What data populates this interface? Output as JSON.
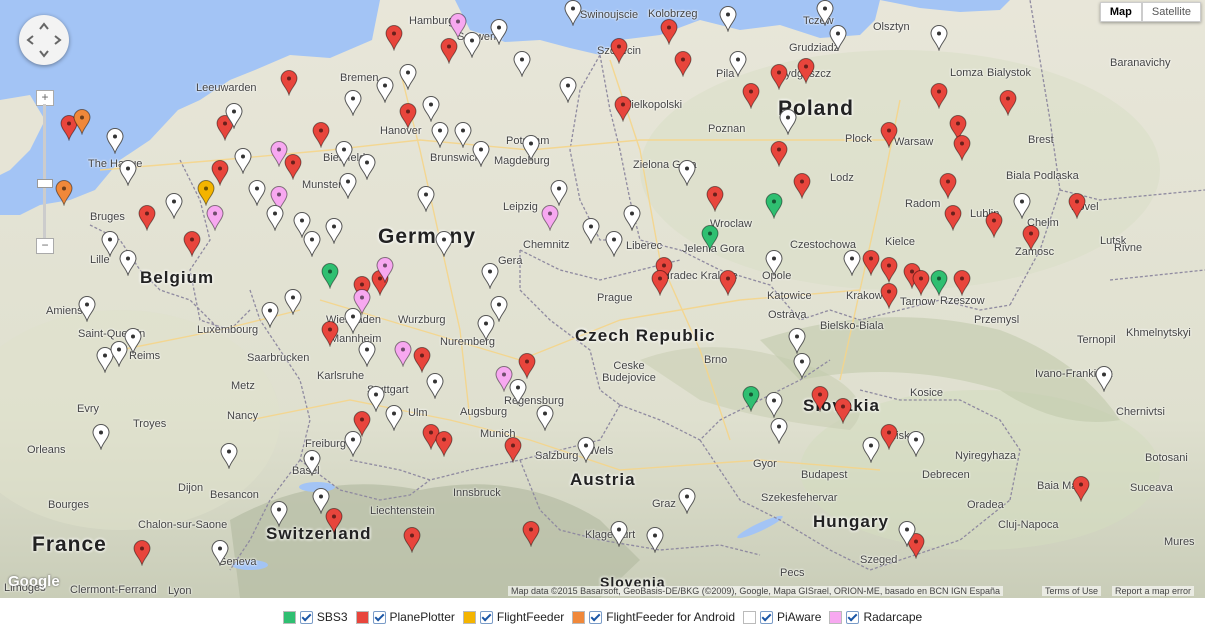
{
  "map_controls": {
    "map_label": "Map",
    "satellite_label": "Satellite",
    "zoom_in": "+",
    "zoom_out": "−"
  },
  "countries": [
    "Poland",
    "Germany",
    "Belgium",
    "Czech Republic",
    "Slovakia",
    "Austria",
    "Hungary",
    "France",
    "Switzerland",
    "Slovenia"
  ],
  "cities": [
    "Hamburg",
    "Schwerin",
    "Swinoujscie",
    "Kolobrzeg",
    "Tczew",
    "Olsztyn",
    "Szczecin",
    "Grudziadz",
    "Bialystok",
    "Baranavichy",
    "Bremen",
    "Pila",
    "Bydgoszcz",
    "Lomza",
    "Wielkopolski",
    "Leeuwarden",
    "Poznan",
    "Brest",
    "Hanover",
    "Potsdam",
    "Plock",
    "Warsaw",
    "The Hague",
    "Bielefeld",
    "Brunswick",
    "Magdeburg",
    "Zielona Gora",
    "Lodz",
    "Biala Podlaska",
    "Munster",
    "Radom",
    "Kovel",
    "Bruges",
    "Leipzig",
    "Wroclaw",
    "Lublin",
    "Chelm",
    "Jelenia Gora",
    "Czestochowa",
    "Kielce",
    "Zamosc",
    "Lille",
    "Chemnitz",
    "Liberec",
    "Lutsk",
    "Gera",
    "Hradec Kralove",
    "Opole",
    "Rivne",
    "Amiens",
    "Katowice",
    "Krakow",
    "Tarnow",
    "Rzeszow",
    "Prague",
    "Ostrava",
    "Bielsko-Biala",
    "Przemysl",
    "Luxembourg",
    "Wiesbaden",
    "Wurzburg",
    "Ternopil",
    "Khmelnytskyi",
    "Saint-Quentin",
    "Mannheim",
    "Nuremberg",
    "Brno",
    "Reims",
    "Saarbrucken",
    "Ceske Budejovice",
    "Ivano-Frankivsk",
    "Metz",
    "Karlsruhe",
    "Stuttgart",
    "Regensburg",
    "Kosice",
    "Evry",
    "Nancy",
    "Ulm",
    "Augsburg",
    "Munich",
    "Chernivtsi",
    "Troyes",
    "Salzburg",
    "Wels",
    "Miskolc",
    "Orleans",
    "Freiburg",
    "Basel",
    "Gyor",
    "Budapest",
    "Nyiregyhaza",
    "Botosani",
    "Dijon",
    "Besancon",
    "Innsbruck",
    "Debrecen",
    "Baia Mare",
    "Suceava",
    "Bourges",
    "Szekesfehervar",
    "Chalon-sur-Saone",
    "Liechtenstein",
    "Graz",
    "Klagenfurt",
    "Oradea",
    "Cluj-Napoca",
    "Geneva",
    "Szeged",
    "Mures",
    "Pecs",
    "Limoges",
    "Clermont-Ferrand",
    "Lyon"
  ],
  "attribution": {
    "data": "Map data ©2015 Basarsoft, GeoBasis-DE/BKG (©2009), Google, Mapa GISrael, ORION-ME, basado en BCN IGN España",
    "terms": "Terms of Use",
    "report": "Report a map error",
    "logo": "Google"
  },
  "legend": [
    {
      "label": "SBS3",
      "color": "#2fbf71"
    },
    {
      "label": "PlanePlotter",
      "color": "#e8453c"
    },
    {
      "label": "FlightFeeder",
      "color": "#f4b400"
    },
    {
      "label": "FlightFeeder for Android",
      "color": "#f0883a"
    },
    {
      "label": "PiAware",
      "color": "#ffffff"
    },
    {
      "label": "Radarcape",
      "color": "#f7a8f0"
    }
  ],
  "markers": [
    {
      "type": "planeplotter",
      "lon": 4.9,
      "lat": 52.4
    },
    {
      "type": "planeplotter",
      "lon": 3.2,
      "lat": 51.0
    },
    {
      "type": "planeplotter",
      "lon": 4.8,
      "lat": 51.7
    },
    {
      "type": "planeplotter",
      "lon": 4.2,
      "lat": 50.6
    },
    {
      "type": "planeplotter",
      "lon": 6.3,
      "lat": 53.1
    },
    {
      "type": "planeplotter",
      "lon": 7.0,
      "lat": 52.3
    },
    {
      "type": "planeplotter",
      "lon": 8.9,
      "lat": 52.6
    },
    {
      "type": "planeplotter",
      "lon": 9.8,
      "lat": 53.6
    },
    {
      "type": "planeplotter",
      "lon": 6.4,
      "lat": 51.8
    },
    {
      "type": "planeplotter",
      "lon": 7.9,
      "lat": 49.9
    },
    {
      "type": "planeplotter",
      "lon": 8.3,
      "lat": 50.0
    },
    {
      "type": "planeplotter",
      "lon": 7.2,
      "lat": 49.2
    },
    {
      "type": "planeplotter",
      "lon": 9.2,
      "lat": 48.8
    },
    {
      "type": "planeplotter",
      "lon": 7.9,
      "lat": 47.8
    },
    {
      "type": "planeplotter",
      "lon": 9.4,
      "lat": 47.6
    },
    {
      "type": "planeplotter",
      "lon": 9.7,
      "lat": 47.5
    },
    {
      "type": "planeplotter",
      "lon": 11.5,
      "lat": 48.7
    },
    {
      "type": "planeplotter",
      "lon": 11.2,
      "lat": 47.4
    },
    {
      "type": "planeplotter",
      "lon": 13.5,
      "lat": 53.6
    },
    {
      "type": "planeplotter",
      "lon": 13.6,
      "lat": 52.7
    },
    {
      "type": "planeplotter",
      "lon": 14.9,
      "lat": 53.4
    },
    {
      "type": "planeplotter",
      "lon": 15.6,
      "lat": 51.3
    },
    {
      "type": "planeplotter",
      "lon": 14.5,
      "lat": 50.2
    },
    {
      "type": "planeplotter",
      "lon": 14.4,
      "lat": 50.0
    },
    {
      "type": "planeplotter",
      "lon": 15.9,
      "lat": 50.0
    },
    {
      "type": "planeplotter",
      "lon": 17.0,
      "lat": 53.2
    },
    {
      "type": "planeplotter",
      "lon": 17.6,
      "lat": 53.3
    },
    {
      "type": "planeplotter",
      "lon": 16.4,
      "lat": 52.9
    },
    {
      "type": "planeplotter",
      "lon": 17.0,
      "lat": 52.0
    },
    {
      "type": "planeplotter",
      "lon": 17.5,
      "lat": 51.5
    },
    {
      "type": "planeplotter",
      "lon": 19.4,
      "lat": 52.3
    },
    {
      "type": "planeplotter",
      "lon": 20.5,
      "lat": 52.9
    },
    {
      "type": "planeplotter",
      "lon": 20.9,
      "lat": 52.4
    },
    {
      "type": "planeplotter",
      "lon": 21.0,
      "lat": 52.1
    },
    {
      "type": "planeplotter",
      "lon": 20.7,
      "lat": 51.5
    },
    {
      "type": "planeplotter",
      "lon": 22.0,
      "lat": 52.8
    },
    {
      "type": "planeplotter",
      "lon": 20.8,
      "lat": 51.0
    },
    {
      "type": "planeplotter",
      "lon": 21.7,
      "lat": 50.9
    },
    {
      "type": "planeplotter",
      "lon": 22.5,
      "lat": 50.7
    },
    {
      "type": "planeplotter",
      "lon": 23.5,
      "lat": 51.2
    },
    {
      "type": "planeplotter",
      "lon": 19.0,
      "lat": 50.3
    },
    {
      "type": "planeplotter",
      "lon": 19.4,
      "lat": 50.2
    },
    {
      "type": "planeplotter",
      "lon": 19.9,
      "lat": 50.1
    },
    {
      "type": "planeplotter",
      "lon": 20.1,
      "lat": 50.0
    },
    {
      "type": "planeplotter",
      "lon": 21.0,
      "lat": 50.0
    },
    {
      "type": "planeplotter",
      "lon": 19.4,
      "lat": 49.8
    },
    {
      "type": "planeplotter",
      "lon": 17.9,
      "lat": 48.2
    },
    {
      "type": "planeplotter",
      "lon": 18.4,
      "lat": 48.0
    },
    {
      "type": "planeplotter",
      "lon": 19.4,
      "lat": 47.6
    },
    {
      "type": "planeplotter",
      "lon": 23.6,
      "lat": 46.8
    },
    {
      "type": "planeplotter",
      "lon": 20.0,
      "lat": 45.9
    },
    {
      "type": "planeplotter",
      "lon": 3.1,
      "lat": 45.8
    },
    {
      "type": "planeplotter",
      "lon": 7.3,
      "lat": 46.3
    },
    {
      "type": "planeplotter",
      "lon": 9.0,
      "lat": 46.0
    },
    {
      "type": "planeplotter",
      "lon": 11.6,
      "lat": 46.1
    },
    {
      "type": "planeplotter",
      "lon": 8.6,
      "lat": 53.8
    },
    {
      "type": "planeplotter",
      "lon": 1.5,
      "lat": 52.4
    },
    {
      "type": "planeplotter",
      "lon": 14.6,
      "lat": 53.9
    },
    {
      "type": "sbs3",
      "lon": 15.5,
      "lat": 50.7
    },
    {
      "type": "sbs3",
      "lon": 16.9,
      "lat": 51.2
    },
    {
      "type": "sbs3",
      "lon": 20.5,
      "lat": 50.0
    },
    {
      "type": "sbs3",
      "lon": 7.2,
      "lat": 50.1
    },
    {
      "type": "sbs3",
      "lon": 16.4,
      "lat": 48.2
    },
    {
      "type": "flightfeeder",
      "lon": 4.5,
      "lat": 51.4
    },
    {
      "type": "flightfeeder-android",
      "lon": 1.8,
      "lat": 52.5
    },
    {
      "type": "flightfeeder-android",
      "lon": 1.4,
      "lat": 51.4
    },
    {
      "type": "radarcape",
      "lon": 6.1,
      "lat": 52.0
    },
    {
      "type": "radarcape",
      "lon": 6.1,
      "lat": 51.3
    },
    {
      "type": "radarcape",
      "lon": 4.7,
      "lat": 51.0
    },
    {
      "type": "radarcape",
      "lon": 8.4,
      "lat": 50.2
    },
    {
      "type": "radarcape",
      "lon": 7.9,
      "lat": 49.7
    },
    {
      "type": "radarcape",
      "lon": 8.8,
      "lat": 48.9
    },
    {
      "type": "radarcape",
      "lon": 11.0,
      "lat": 48.5
    },
    {
      "type": "radarcape",
      "lon": 12.0,
      "lat": 51.0
    },
    {
      "type": "radarcape",
      "lon": 10.0,
      "lat": 54.0
    },
    {
      "type": "piaware",
      "lon": 2.5,
      "lat": 52.2
    },
    {
      "type": "piaware",
      "lon": 2.8,
      "lat": 51.7
    },
    {
      "type": "piaware",
      "lon": 3.8,
      "lat": 51.2
    },
    {
      "type": "piaware",
      "lon": 5.1,
      "lat": 52.6
    },
    {
      "type": "piaware",
      "lon": 5.3,
      "lat": 51.9
    },
    {
      "type": "piaware",
      "lon": 5.6,
      "lat": 51.4
    },
    {
      "type": "piaware",
      "lon": 6.0,
      "lat": 51.0
    },
    {
      "type": "piaware",
      "lon": 6.6,
      "lat": 50.9
    },
    {
      "type": "piaware",
      "lon": 6.8,
      "lat": 50.6
    },
    {
      "type": "piaware",
      "lon": 7.3,
      "lat": 50.8
    },
    {
      "type": "piaware",
      "lon": 7.6,
      "lat": 51.5
    },
    {
      "type": "piaware",
      "lon": 7.5,
      "lat": 52.0
    },
    {
      "type": "piaware",
      "lon": 7.7,
      "lat": 52.8
    },
    {
      "type": "piaware",
      "lon": 8.4,
      "lat": 53.0
    },
    {
      "type": "piaware",
      "lon": 8.9,
      "lat": 53.2
    },
    {
      "type": "piaware",
      "lon": 9.4,
      "lat": 52.7
    },
    {
      "type": "piaware",
      "lon": 9.6,
      "lat": 52.3
    },
    {
      "type": "piaware",
      "lon": 10.1,
      "lat": 52.3
    },
    {
      "type": "piaware",
      "lon": 10.5,
      "lat": 52.0
    },
    {
      "type": "piaware",
      "lon": 11.6,
      "lat": 52.1
    },
    {
      "type": "piaware",
      "lon": 12.2,
      "lat": 51.4
    },
    {
      "type": "piaware",
      "lon": 12.9,
      "lat": 50.8
    },
    {
      "type": "piaware",
      "lon": 13.4,
      "lat": 50.6
    },
    {
      "type": "piaware",
      "lon": 13.8,
      "lat": 51.0
    },
    {
      "type": "piaware",
      "lon": 12.4,
      "lat": 53.0
    },
    {
      "type": "piaware",
      "lon": 11.4,
      "lat": 53.4
    },
    {
      "type": "piaware",
      "lon": 10.3,
      "lat": 53.7
    },
    {
      "type": "piaware",
      "lon": 10.9,
      "lat": 53.9
    },
    {
      "type": "piaware",
      "lon": 12.5,
      "lat": 54.2
    },
    {
      "type": "piaware",
      "lon": 15.9,
      "lat": 54.1
    },
    {
      "type": "piaware",
      "lon": 18.0,
      "lat": 54.2
    },
    {
      "type": "piaware",
      "lon": 20.5,
      "lat": 53.8
    },
    {
      "type": "piaware",
      "lon": 17.2,
      "lat": 52.5
    },
    {
      "type": "piaware",
      "lon": 15.0,
      "lat": 51.7
    },
    {
      "type": "piaware",
      "lon": 16.9,
      "lat": 50.3
    },
    {
      "type": "piaware",
      "lon": 18.6,
      "lat": 50.3
    },
    {
      "type": "piaware",
      "lon": 22.3,
      "lat": 51.2
    },
    {
      "type": "piaware",
      "lon": 17.4,
      "lat": 49.1
    },
    {
      "type": "piaware",
      "lon": 17.5,
      "lat": 48.7
    },
    {
      "type": "piaware",
      "lon": 16.9,
      "lat": 48.1
    },
    {
      "type": "piaware",
      "lon": 17.0,
      "lat": 47.7
    },
    {
      "type": "piaware",
      "lon": 19.0,
      "lat": 47.4
    },
    {
      "type": "piaware",
      "lon": 20.0,
      "lat": 47.5
    },
    {
      "type": "piaware",
      "lon": 19.8,
      "lat": 46.1
    },
    {
      "type": "piaware",
      "lon": 24.1,
      "lat": 48.5
    },
    {
      "type": "piaware",
      "lon": 15.0,
      "lat": 46.6
    },
    {
      "type": "piaware",
      "lon": 14.3,
      "lat": 46.0
    },
    {
      "type": "piaware",
      "lon": 13.5,
      "lat": 46.1
    },
    {
      "type": "piaware",
      "lon": 12.8,
      "lat": 47.4
    },
    {
      "type": "piaware",
      "lon": 11.9,
      "lat": 47.9
    },
    {
      "type": "piaware",
      "lon": 11.3,
      "lat": 48.3
    },
    {
      "type": "piaware",
      "lon": 10.9,
      "lat": 49.6
    },
    {
      "type": "piaware",
      "lon": 10.6,
      "lat": 49.3
    },
    {
      "type": "piaware",
      "lon": 9.5,
      "lat": 48.4
    },
    {
      "type": "piaware",
      "lon": 8.2,
      "lat": 48.2
    },
    {
      "type": "piaware",
      "lon": 8.6,
      "lat": 47.9
    },
    {
      "type": "piaware",
      "lon": 7.7,
      "lat": 47.5
    },
    {
      "type": "piaware",
      "lon": 6.8,
      "lat": 47.2
    },
    {
      "type": "piaware",
      "lon": 7.0,
      "lat": 46.6
    },
    {
      "type": "piaware",
      "lon": 6.1,
      "lat": 46.4
    },
    {
      "type": "piaware",
      "lon": 5.0,
      "lat": 47.3
    },
    {
      "type": "piaware",
      "lon": 4.8,
      "lat": 45.8
    },
    {
      "type": "piaware",
      "lon": 2.2,
      "lat": 47.6
    },
    {
      "type": "piaware",
      "lon": 2.3,
      "lat": 48.8
    },
    {
      "type": "piaware",
      "lon": 2.6,
      "lat": 48.9
    },
    {
      "type": "piaware",
      "lon": 2.9,
      "lat": 49.1
    },
    {
      "type": "piaware",
      "lon": 1.9,
      "lat": 49.6
    },
    {
      "type": "piaware",
      "lon": 2.4,
      "lat": 50.6
    },
    {
      "type": "piaware",
      "lon": 2.8,
      "lat": 50.3
    },
    {
      "type": "piaware",
      "lon": 5.9,
      "lat": 49.5
    },
    {
      "type": "piaware",
      "lon": 6.4,
      "lat": 49.7
    },
    {
      "type": "piaware",
      "lon": 7.7,
      "lat": 49.4
    },
    {
      "type": "piaware",
      "lon": 8.0,
      "lat": 48.9
    },
    {
      "type": "piaware",
      "lon": 9.7,
      "lat": 50.6
    },
    {
      "type": "piaware",
      "lon": 10.7,
      "lat": 50.1
    },
    {
      "type": "piaware",
      "lon": 9.3,
      "lat": 51.3
    },
    {
      "type": "piaware",
      "lon": 8.0,
      "lat": 51.8
    },
    {
      "type": "piaware",
      "lon": 16.1,
      "lat": 53.4
    },
    {
      "type": "piaware",
      "lon": 18.3,
      "lat": 53.8
    }
  ]
}
